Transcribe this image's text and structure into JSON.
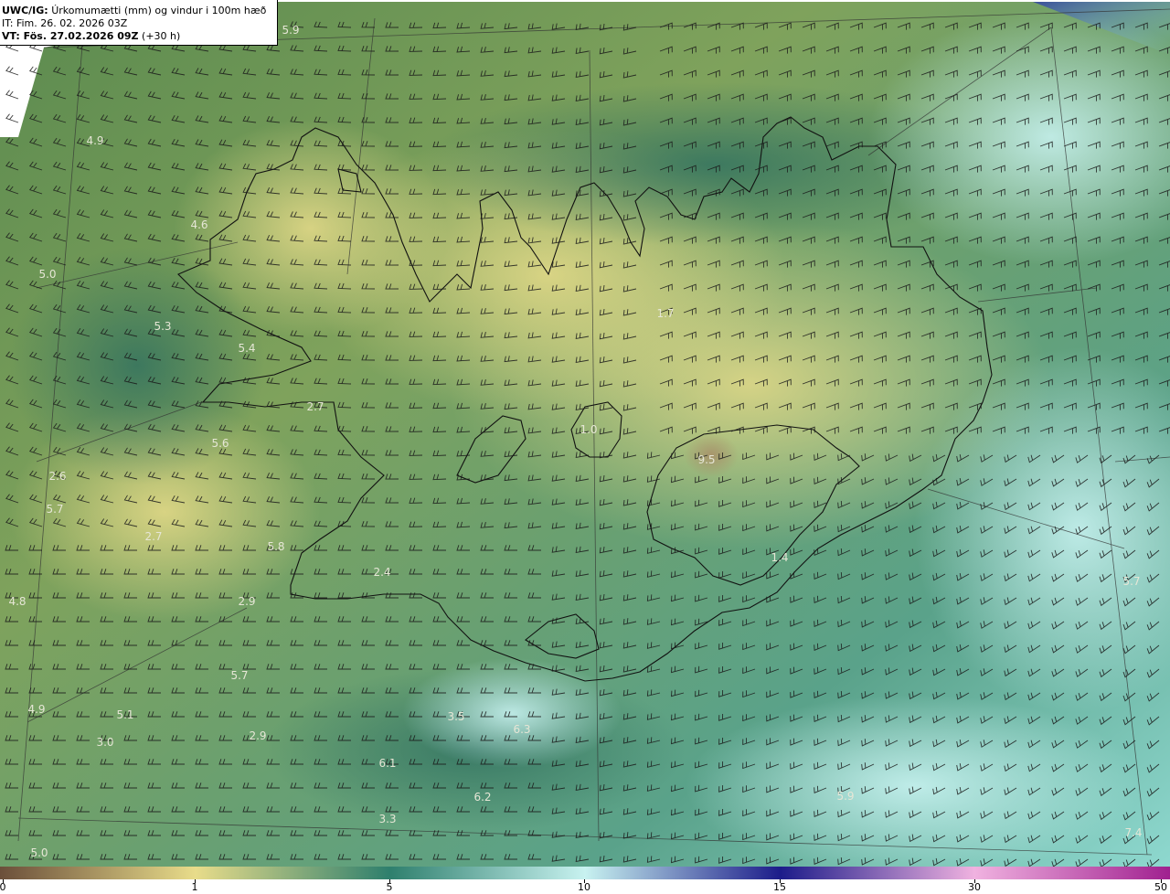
{
  "header": {
    "product": "UWC/IG:",
    "description": "Úrkomumætti (mm) og vindur i 100m hæð",
    "issue_time": "IT: Fim. 26. 02. 2026 03Z",
    "valid_label": "VT: Fös. 27.02.2026 09Z",
    "valid_offset": "(+30 h)"
  },
  "map_labels": [
    "5.9",
    "4.9",
    "4.6",
    "5.0",
    "5.3",
    "5.4",
    "2.7",
    "5.6",
    "2.6",
    "5.7",
    "2.7",
    "5.8",
    "2.4",
    "4.8",
    "2.9",
    "5.7",
    "4.9",
    "5.1",
    "3.0",
    "2.9",
    "3.5",
    "6.3",
    "6.1",
    "6.2",
    "3.3",
    "5.0",
    "1.7",
    "1.0",
    "9.5",
    "1.4",
    "5.7",
    "5.9",
    "7.4"
  ],
  "colorbar": {
    "ticks": [
      "0",
      "1",
      "5",
      "10",
      "15",
      "30",
      "50"
    ],
    "tick_values": [
      0,
      1,
      5,
      10,
      15,
      30,
      50
    ],
    "colors": [
      "#6b4f3a",
      "#e8dc8a",
      "#2e7f6d",
      "#c8f2f0",
      "#1c1c8a",
      "#f0b2e0",
      "#a0208f"
    ]
  }
}
